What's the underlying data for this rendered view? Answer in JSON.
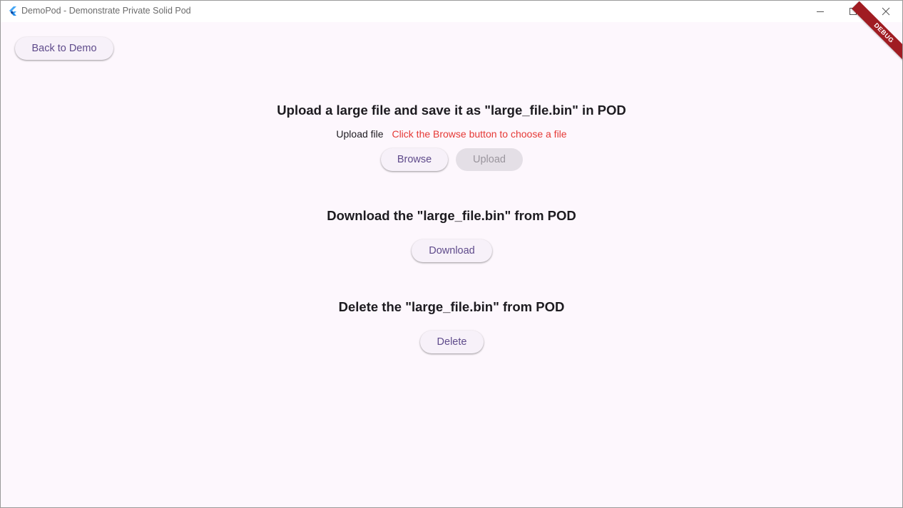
{
  "window": {
    "title": "DemoPod - Demonstrate Private Solid Pod"
  },
  "colors": {
    "background": "#fdf7fd",
    "button_text": "#5f4b8b",
    "hint_red": "#e53935",
    "debug_banner": "#a01c22"
  },
  "toolbar": {
    "back_label": "Back to Demo"
  },
  "upload_section": {
    "heading": "Upload a large file and save it as \"large_file.bin\" in POD",
    "label": "Upload file",
    "hint": "Click the Browse button to choose a file",
    "browse_label": "Browse",
    "upload_label": "Upload"
  },
  "download_section": {
    "heading": "Download the \"large_file.bin\" from POD",
    "download_label": "Download"
  },
  "delete_section": {
    "heading": "Delete the \"large_file.bin\" from POD",
    "delete_label": "Delete"
  },
  "debug_banner": {
    "text": "DEBUG"
  }
}
